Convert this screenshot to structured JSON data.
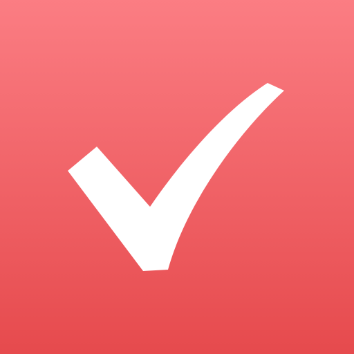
{
  "icon": {
    "name": "checkmark-icon",
    "gradient_top": "#fb7d83",
    "gradient_bottom": "#e64a4d",
    "glyph_color": "#ffffff"
  }
}
